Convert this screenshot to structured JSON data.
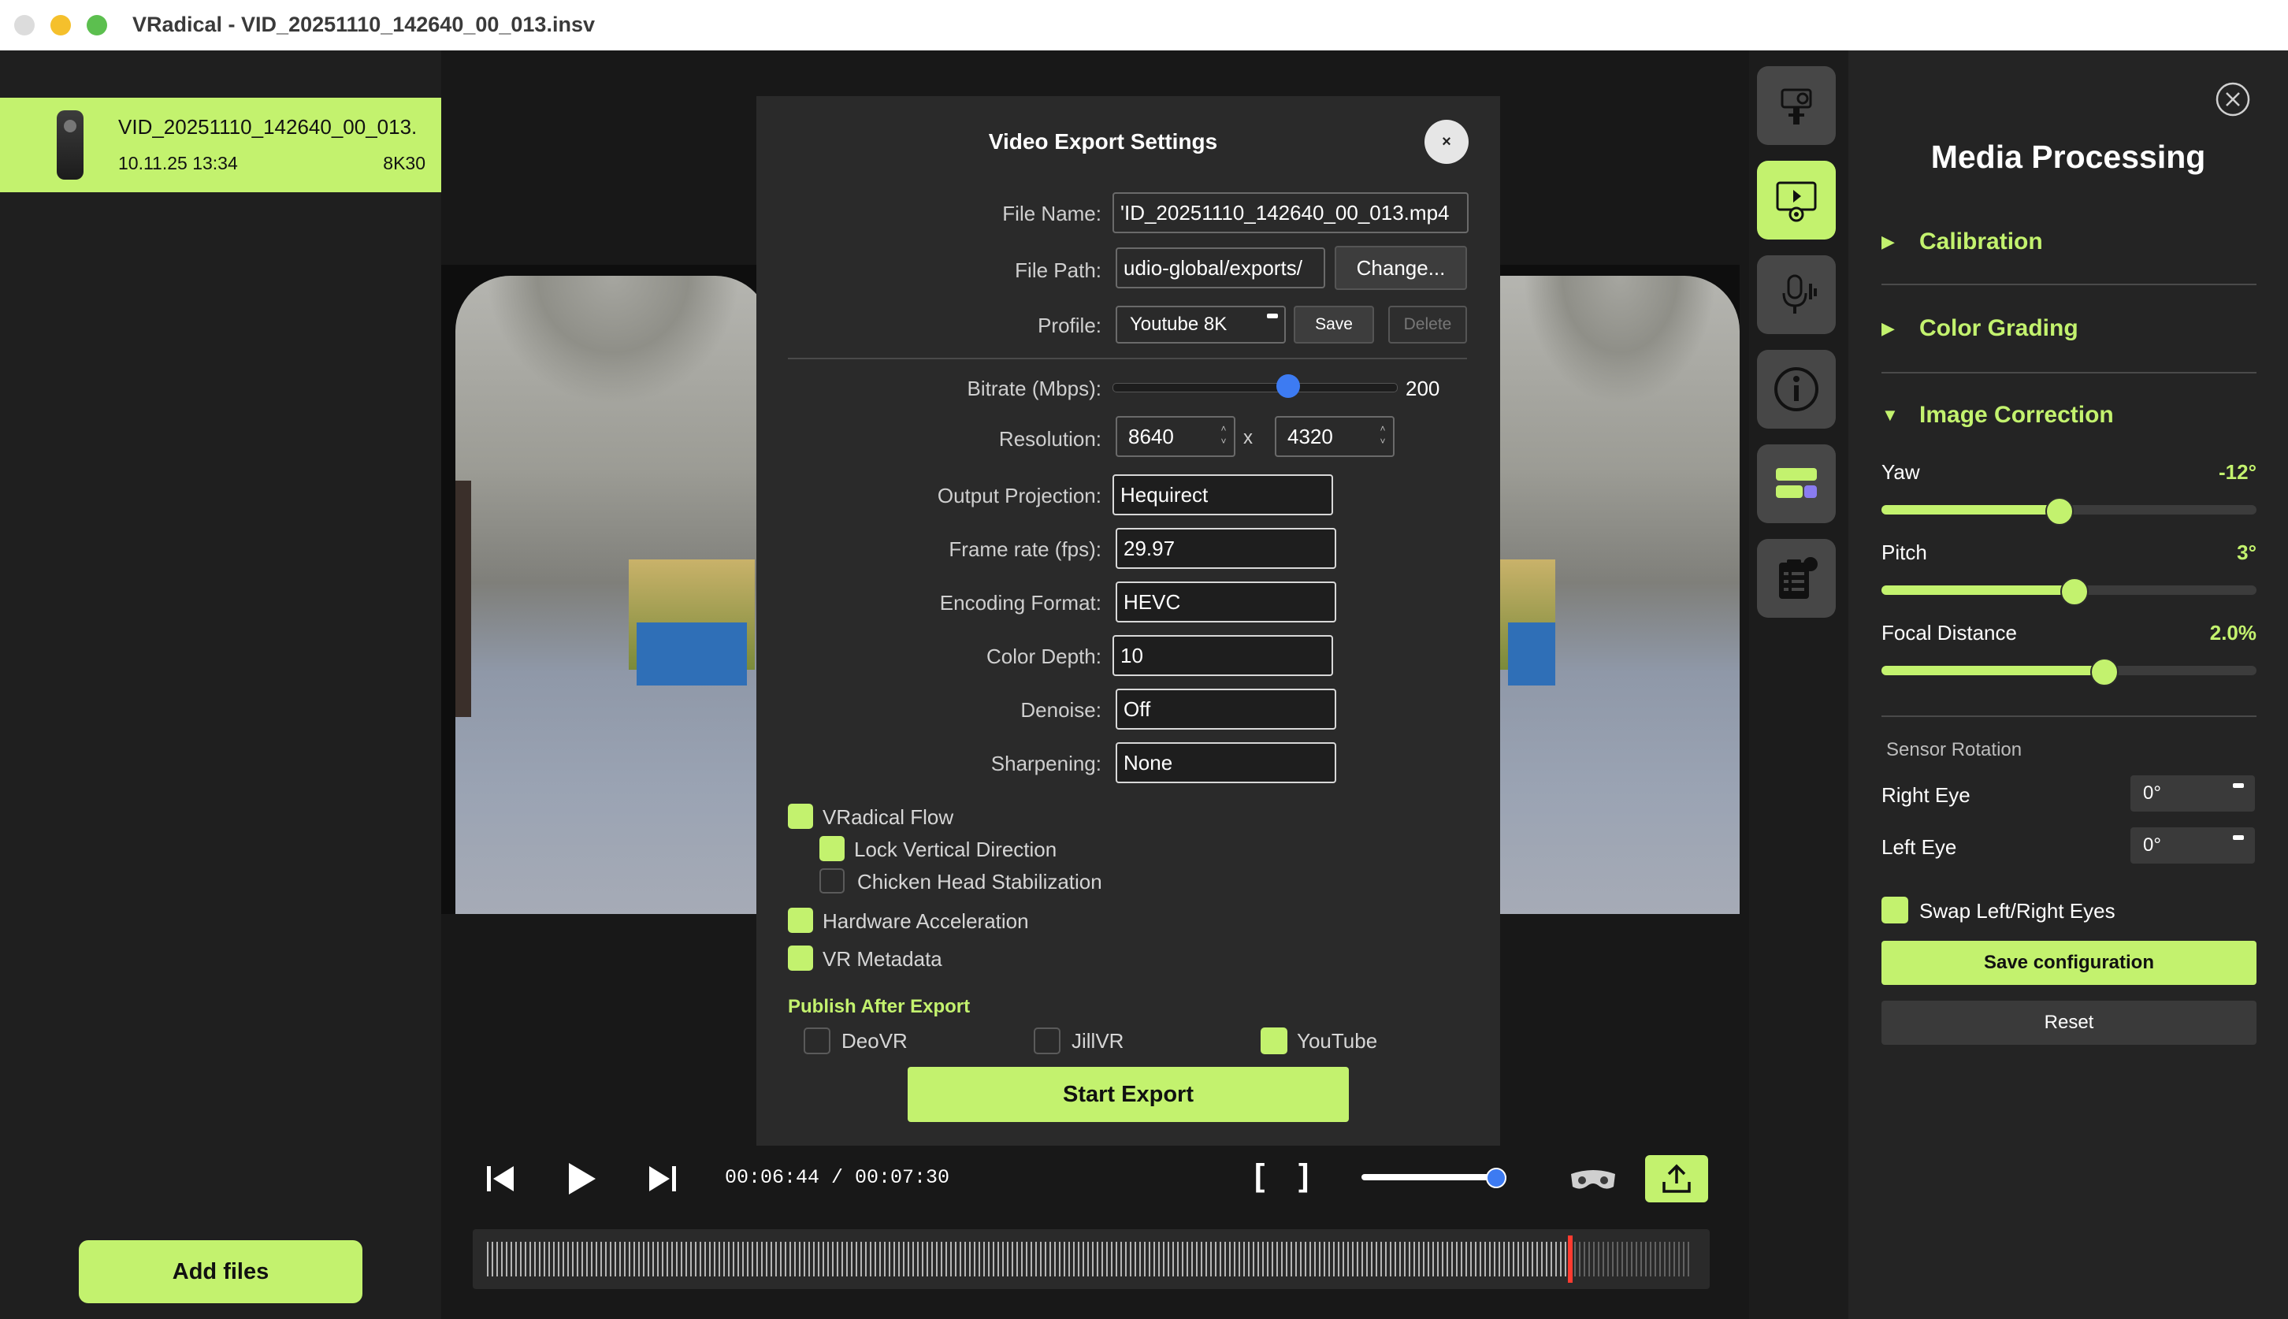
{
  "window": {
    "title": "VRadical - VID_20251110_142640_00_013.insv",
    "traffic_lights": {
      "close": "#dcdcdc",
      "minimize": "#f5c02c",
      "zoom": "#5cbf4f"
    }
  },
  "colors": {
    "accent": "#c3f26e",
    "slider_blue": "#3d7bf2",
    "playhead": "#ff3b30"
  },
  "file_list": {
    "items": [
      {
        "name": "VID_20251110_142640_00_013.",
        "date": "10.11.25 13:34",
        "resolution": "8K30",
        "icon": "camera-icon"
      }
    ],
    "add_files_label": "Add files"
  },
  "player": {
    "time": "00:06:44 / 00:07:30",
    "bracket_in": "[",
    "bracket_out": "]",
    "volume": 0.92,
    "timeline_position": 0.9,
    "icons": [
      "skip-back-icon",
      "play-icon",
      "skip-forward-icon",
      "vr-headset-icon",
      "export-upload-icon"
    ]
  },
  "toolbar": {
    "tools": [
      {
        "name": "camera-tool",
        "icon": "action-camera-icon",
        "active": false
      },
      {
        "name": "media-processing-tool",
        "icon": "film-gear-icon",
        "active": true
      },
      {
        "name": "audio-tool",
        "icon": "microphone-icon",
        "active": false
      },
      {
        "name": "info-tool",
        "icon": "info-icon",
        "active": false
      },
      {
        "name": "layout-tool",
        "icon": "layers-icon",
        "active": false
      },
      {
        "name": "tasks-tool",
        "icon": "clipboard-icon",
        "active": false
      }
    ]
  },
  "export_dialog": {
    "title": "Video Export Settings",
    "close_label": "×",
    "file_name_label": "File Name:",
    "file_name_value": "'ID_20251110_142640_00_013.mp4",
    "file_path_label": "File Path:",
    "file_path_value": "udio-global/exports/",
    "change_label": "Change...",
    "profile_label": "Profile:",
    "profile_value": "Youtube 8K",
    "save_label": "Save",
    "delete_label": "Delete",
    "bitrate_label": "Bitrate (Mbps):",
    "bitrate_value": "200",
    "bitrate_fraction": 0.62,
    "resolution_label": "Resolution:",
    "resolution_width": "8640",
    "resolution_x": "x",
    "resolution_height": "4320",
    "projection_label": "Output Projection:",
    "projection_value": "Hequirect",
    "framerate_label": "Frame rate (fps):",
    "framerate_value": "29.97",
    "encoding_label": "Encoding Format:",
    "encoding_value": "HEVC",
    "color_depth_label": "Color Depth:",
    "color_depth_value": "10",
    "denoise_label": "Denoise:",
    "denoise_value": "Off",
    "sharpening_label": "Sharpening:",
    "sharpening_value": "None",
    "options": {
      "vradical_flow": {
        "label": "VRadical Flow",
        "checked": true
      },
      "lock_vertical": {
        "label": "Lock Vertical Direction",
        "checked": true
      },
      "chicken_head": {
        "label": "Chicken Head Stabilization",
        "checked": false
      },
      "hardware_accel": {
        "label": "Hardware Acceleration",
        "checked": true
      },
      "vr_metadata": {
        "label": "VR Metadata",
        "checked": true
      }
    },
    "publish_title": "Publish After Export",
    "publish": {
      "deovr": {
        "label": "DeoVR",
        "checked": false
      },
      "jillvr": {
        "label": "JillVR",
        "checked": false
      },
      "youtube": {
        "label": "YouTube",
        "checked": true
      }
    },
    "start_label": "Start Export"
  },
  "media_processing": {
    "title": "Media Processing",
    "sections": {
      "calibration": {
        "label": "Calibration",
        "arrow": "▶"
      },
      "color_grading": {
        "label": "Color Grading",
        "arrow": "▶"
      },
      "image_correction": {
        "label": "Image Correction",
        "arrow": "▼"
      }
    },
    "yaw": {
      "label": "Yaw",
      "value": "-12°",
      "fraction": 0.47
    },
    "pitch": {
      "label": "Pitch",
      "value": "3°",
      "fraction": 0.51
    },
    "focal": {
      "label": "Focal Distance",
      "value": "2.0%",
      "fraction": 0.59
    },
    "sensor_rotation_label": "Sensor Rotation",
    "right_eye": {
      "label": "Right Eye",
      "value": "0°"
    },
    "left_eye": {
      "label": "Left Eye",
      "value": "0°"
    },
    "swap_eyes": {
      "label": "Swap Left/Right Eyes",
      "checked": true
    },
    "save_label": "Save configuration",
    "reset_label": "Reset"
  }
}
